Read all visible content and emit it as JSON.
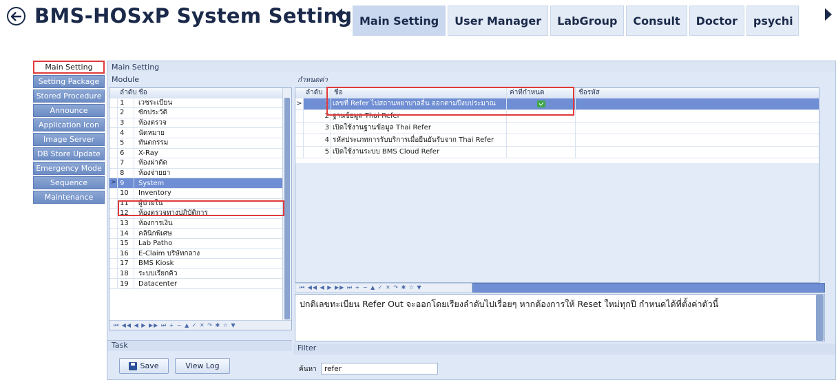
{
  "header": {
    "title": "BMS-HOSxP System Setting",
    "tabs": [
      "Main Setting",
      "User Manager",
      "LabGroup",
      "Consult",
      "Doctor",
      "psychi"
    ],
    "active_tab": 0
  },
  "nav": {
    "items": [
      "Main Setting",
      "Setting Package",
      "Stored Procedure",
      "Announce",
      "Application Icon",
      "Image Server",
      "DB Store Update",
      "Emergency Mode",
      "Sequence",
      "Maintenance"
    ],
    "selected": 0
  },
  "main": {
    "title": "Main Setting",
    "module_label": "Module",
    "module_columns": [
      "ลำดับ",
      "ชื่อ"
    ],
    "modules": [
      [
        "1",
        "เวชระเบียน"
      ],
      [
        "2",
        "ซักประวัติ"
      ],
      [
        "3",
        "ห้องตรวจ"
      ],
      [
        "4",
        "นัดหมาย"
      ],
      [
        "5",
        "ทันตกรรม"
      ],
      [
        "6",
        "X-Ray"
      ],
      [
        "7",
        "ห้องผ่าตัด"
      ],
      [
        "8",
        "ห้องจ่ายยา"
      ],
      [
        "9",
        "System"
      ],
      [
        "10",
        "Inventory"
      ],
      [
        "11",
        "ผู้ป่วยใน"
      ],
      [
        "12",
        "ห้องตรวจทางปฏิบัติการ"
      ],
      [
        "13",
        "ห้องการเงิน"
      ],
      [
        "14",
        "คลินิกพิเศษ"
      ],
      [
        "15",
        "Lab Patho"
      ],
      [
        "16",
        "E-Claim บริษัทกลาง"
      ],
      [
        "17",
        "BMS Kiosk"
      ],
      [
        "18",
        "ระบบเรียกคิว"
      ],
      [
        "19",
        "Datacenter"
      ]
    ],
    "selected_module": 8,
    "settings_label": "กำหนดค่า",
    "settings_columns": [
      "ลำดับ",
      "ชื่อ",
      "ค่าที่กำหนด",
      "ชื่อรหัส"
    ],
    "settings": [
      {
        "no": "1",
        "name": "เลขที่ Refer ไปสถานพยาบาลอื่น ออกตามปีงบประมาณ",
        "checked": true
      },
      {
        "no": "2",
        "name": "ฐานข้อมูล Thai Refer",
        "checked": false
      },
      {
        "no": "3",
        "name": "เปิดใช้งานฐานข้อมูล Thai Refer",
        "checked": false
      },
      {
        "no": "4",
        "name": "รหัสประเภทการรับบริการเมื่อยืนยันรับจาก Thai Refer",
        "checked": false
      },
      {
        "no": "5",
        "name": "เปิดใช้งานระบบ BMS Cloud Refer",
        "checked": false
      }
    ],
    "description": "ปกติเลขทะเบียน Refer Out จะออกโดยเรียงลำดับไปเรื่อยๆ หากต้องการให้ Reset ใหม่ทุกปี กำหนดได้ที่ตั้งค่าตัวนี้",
    "navigator_glyphs": "⏮ ◀◀ ◀ ▶ ▶▶ ⏭ + − ▲ ✓ ✕ ↷ ✱ ☆ ▼",
    "task_label": "Task",
    "save_label": "Save",
    "viewlog_label": "View Log",
    "filter_label": "Filter",
    "search_label": "ค้นหา",
    "search_value": "refer"
  },
  "colors": {
    "accent": "#1b2a4a",
    "selection": "#6f8ed3",
    "highlight_box": "#e03a3a"
  }
}
